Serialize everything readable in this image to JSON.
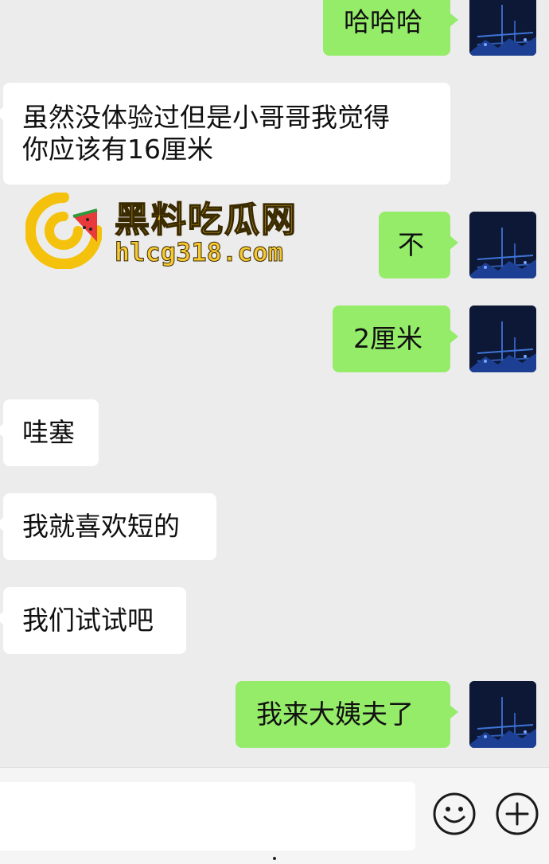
{
  "messages": [
    {
      "side": "out",
      "text": "哈哈哈"
    },
    {
      "side": "in",
      "lines": [
        "虽然没体验过但是小哥哥我觉得",
        "你应该有16厘米"
      ]
    },
    {
      "side": "out",
      "text": "不"
    },
    {
      "side": "out",
      "text": "2厘米"
    },
    {
      "side": "in",
      "text": "哇塞"
    },
    {
      "side": "in",
      "text": "我就喜欢短的"
    },
    {
      "side": "in",
      "text": "我们试试吧"
    },
    {
      "side": "out",
      "text": "我来大姨夫了"
    }
  ],
  "watermark": {
    "title": "黑料吃瓜网",
    "url": "hlcg318.com"
  },
  "input_bar": {
    "value": "",
    "icons": [
      "emoji-icon",
      "plus-icon"
    ]
  },
  "colors": {
    "outgoing_bubble": "#95ec69",
    "incoming_bubble": "#ffffff",
    "background": "#ececec",
    "watermark_gold": "#f6c832"
  }
}
